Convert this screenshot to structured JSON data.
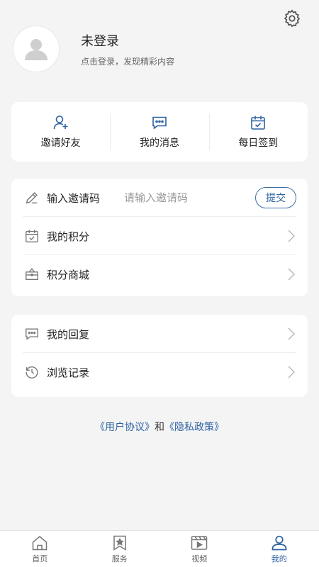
{
  "settings": {
    "icon": "gear-icon"
  },
  "profile": {
    "avatar_icon": "user-avatar-icon",
    "title": "未登录",
    "subtitle": "点击登录，发现精彩内容"
  },
  "quick_actions": [
    {
      "label": "邀请好友",
      "icon": "add-user-icon"
    },
    {
      "label": "我的消息",
      "icon": "message-icon"
    },
    {
      "label": "每日签到",
      "icon": "calendar-check-icon"
    }
  ],
  "invite": {
    "label": "输入邀请码",
    "placeholder": "请输入邀请码",
    "value": "",
    "submit_label": "提交",
    "icon": "pencil-icon"
  },
  "list1": [
    {
      "label": "我的积分",
      "icon": "points-icon"
    },
    {
      "label": "积分商城",
      "icon": "shop-icon"
    }
  ],
  "list2": [
    {
      "label": "我的回复",
      "icon": "reply-icon"
    },
    {
      "label": "浏览记录",
      "icon": "history-icon"
    }
  ],
  "agreement": {
    "user_agreement": "《用户协议》",
    "connector": "和",
    "privacy_policy": "《隐私政策》"
  },
  "tabs": [
    {
      "label": "首页",
      "icon": "home-icon",
      "active": false
    },
    {
      "label": "服务",
      "icon": "bookmark-star-icon",
      "active": false
    },
    {
      "label": "视频",
      "icon": "video-icon",
      "active": false
    },
    {
      "label": "我的",
      "icon": "user-icon",
      "active": true
    }
  ],
  "colors": {
    "accent": "#2c62a0",
    "background": "#f4f4f5",
    "card": "#ffffff"
  }
}
